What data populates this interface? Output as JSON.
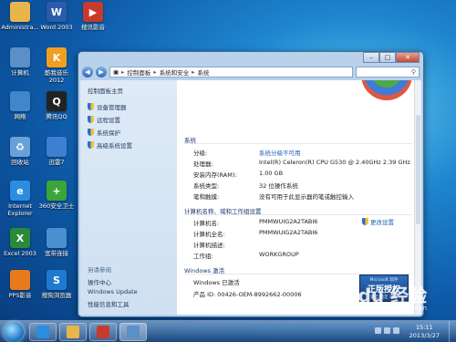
{
  "desktop": {
    "icons": [
      {
        "label": "Administra...",
        "icon": "user-folder-icon",
        "color": "#e8b54a",
        "glyph": ""
      },
      {
        "label": "Word 2003",
        "icon": "word-icon",
        "color": "#2a5caa",
        "glyph": "W"
      },
      {
        "label": "搜讯影音",
        "icon": "media-player-icon",
        "color": "#c83a2c",
        "glyph": "▶"
      },
      {
        "label": "计算机",
        "icon": "computer-icon",
        "color": "#5a8fc8",
        "glyph": ""
      },
      {
        "label": "酷我音乐\n2012",
        "icon": "kuwo-music-icon",
        "color": "#f0a020",
        "glyph": "K"
      },
      {
        "label": "网络",
        "icon": "network-icon",
        "color": "#3f87c9",
        "glyph": ""
      },
      {
        "label": "腾讯QQ",
        "icon": "qq-icon",
        "color": "#222222",
        "glyph": "Q"
      },
      {
        "label": "回收站",
        "icon": "recycle-bin-icon",
        "color": "#6aa0d8",
        "glyph": "♻"
      },
      {
        "label": "迅雷7",
        "icon": "xunlei-icon",
        "color": "#3d7fd0",
        "glyph": ""
      },
      {
        "label": "Internet\nExplorer",
        "icon": "internet-explorer-icon",
        "color": "#2b8de0",
        "glyph": "e"
      },
      {
        "label": "360安全卫士",
        "icon": "security-360-icon",
        "color": "#3ba53a",
        "glyph": "+"
      },
      {
        "label": "Excel 2003",
        "icon": "excel-icon",
        "color": "#2a8a3a",
        "glyph": "X"
      },
      {
        "label": "宽带连接",
        "icon": "broadband-icon",
        "color": "#4a90d0",
        "glyph": ""
      },
      {
        "label": "PPS影音",
        "icon": "pps-icon",
        "color": "#e87a1c",
        "glyph": ""
      },
      {
        "label": "搜狗浏览器",
        "icon": "sogou-browser-icon",
        "color": "#1e7ad0",
        "glyph": "S"
      }
    ]
  },
  "window": {
    "address": {
      "segments": [
        "控制面板",
        "系统和安全",
        "系统"
      ],
      "search_icon": "search-icon"
    },
    "controls": {
      "minimize": "–",
      "maximize": "□",
      "close": "✕"
    },
    "left_pane": {
      "home": "控制面板主页",
      "links": [
        "设备管理器",
        "远程设置",
        "系统保护",
        "高级系统设置"
      ],
      "see_also_title": "另请参阅",
      "see_also": [
        "操作中心",
        "Windows Update",
        "性能信息和工具"
      ]
    },
    "system": {
      "title": "系统",
      "rows": [
        {
          "key": "分级:",
          "value": "系统分级不可用",
          "link": true
        },
        {
          "key": "处理器:",
          "value": "Intel(R) Celeron(R) CPU G530 @ 2.40GHz   2.39 GHz",
          "link": false
        },
        {
          "key": "安装内存(RAM):",
          "value": "1.00 GB",
          "link": false
        },
        {
          "key": "系统类型:",
          "value": "32 位操作系统",
          "link": false
        },
        {
          "key": "笔和触摸:",
          "value": "没有可用于此显示器的笔或触控输入",
          "link": false
        }
      ]
    },
    "computer": {
      "title": "计算机名称、域和工作组设置",
      "change_label": "更改设置",
      "rows": [
        {
          "key": "计算机名:",
          "value": "PMMWUIG2A2TABI6"
        },
        {
          "key": "计算机全名:",
          "value": "PMMWUIG2A2TABI6"
        },
        {
          "key": "计算机描述:",
          "value": ""
        },
        {
          "key": "工作组:",
          "value": "WORKGROUP"
        }
      ]
    },
    "activation": {
      "title": "Windows 激活",
      "status": "Windows 已激活",
      "product_id": "产品 ID: 00426-OEM-8992662-00006",
      "genuine_top": "Microsoft 软件",
      "genuine_main": "正版授权",
      "genuine_bottom": "安全 稳定 声誉"
    }
  },
  "watermark": {
    "main": "Bai du 经验",
    "sub": "jingyan.baidu.com"
  },
  "taskbar": {
    "time": "15:11",
    "date": "2013/3/27",
    "items": [
      {
        "icon": "ie-taskbar-icon",
        "color": "#2b8de0"
      },
      {
        "icon": "explorer-taskbar-icon",
        "color": "#e8b54a"
      },
      {
        "icon": "media-taskbar-icon",
        "color": "#c83a2c"
      },
      {
        "icon": "control-panel-taskbar-icon",
        "color": "#5a8fc8"
      }
    ]
  }
}
